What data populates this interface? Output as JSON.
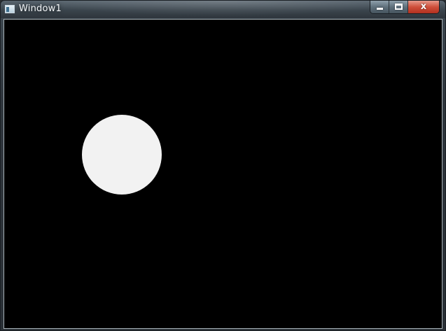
{
  "window": {
    "title": "Window1",
    "close_glyph": "x"
  },
  "icons": {
    "app": "window-app-icon",
    "minimize": "minimize-icon",
    "maximize": "maximize-icon",
    "close": "close-icon"
  },
  "colors": {
    "canvas_background": "#000000",
    "circle_fill": "#f2f2f2",
    "close_button": "#c8402c"
  }
}
